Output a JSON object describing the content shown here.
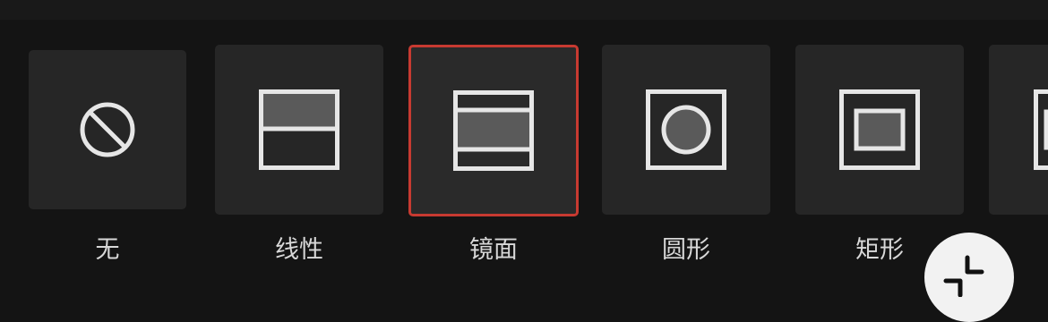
{
  "colors": {
    "background": "#141414",
    "tile": "#262626",
    "selected_border": "#c73a31",
    "icon_stroke": "#e6e6e6",
    "icon_fill": "#5a5a5a",
    "label_text": "#d8d8d8"
  },
  "mask_options": [
    {
      "label": "无",
      "icon": "none-icon",
      "selected": false
    },
    {
      "label": "线性",
      "icon": "linear-mask-icon",
      "selected": false
    },
    {
      "label": "镜面",
      "icon": "mirror-mask-icon",
      "selected": true
    },
    {
      "label": "圆形",
      "icon": "circle-mask-icon",
      "selected": false
    },
    {
      "label": "矩形",
      "icon": "rectangle-mask-icon",
      "selected": false
    }
  ],
  "floating_button": {
    "icon": "collapse-icon"
  }
}
